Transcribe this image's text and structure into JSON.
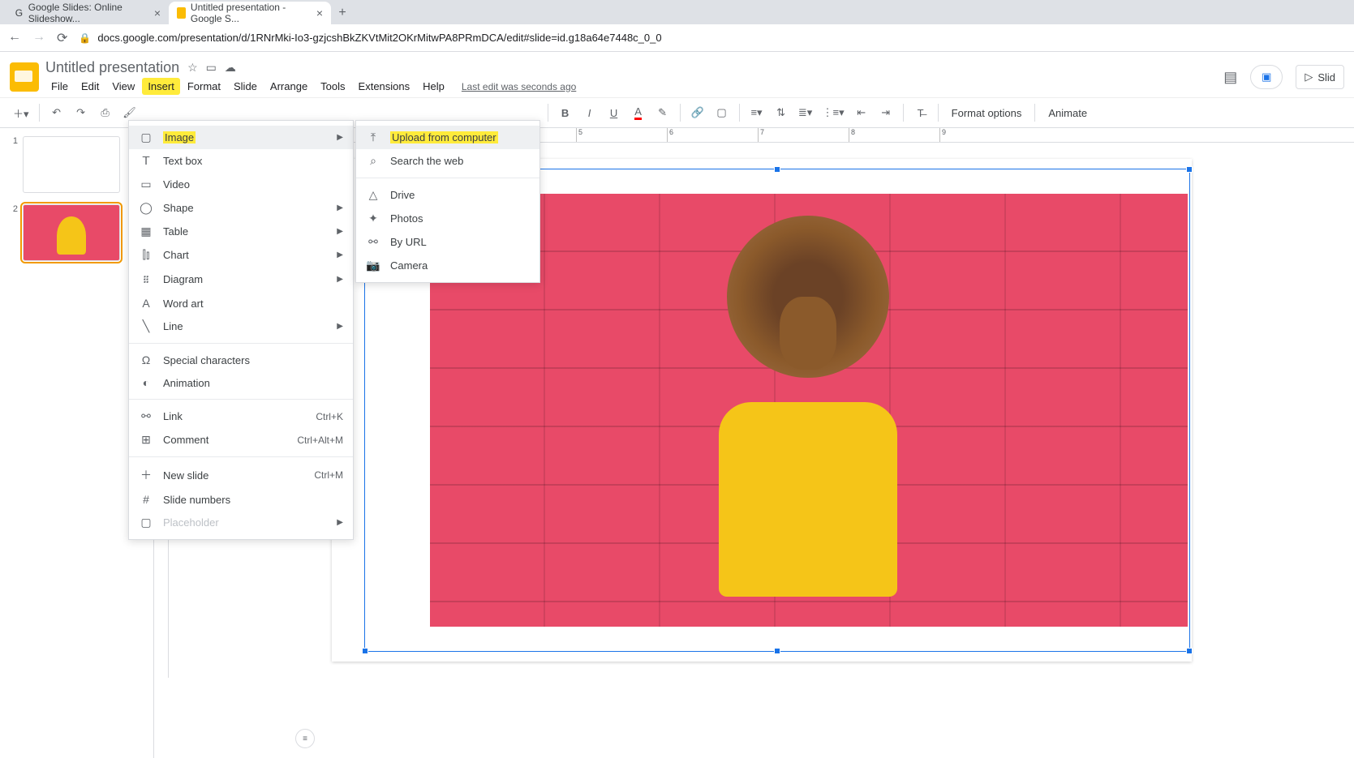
{
  "browser": {
    "tabs": [
      {
        "title": "Google Slides: Online Slideshow...",
        "active": false
      },
      {
        "title": "Untitled presentation - Google S...",
        "active": true
      }
    ],
    "url": "docs.google.com/presentation/d/1RNrMki-Io3-gzjcshBkZKVtMit2OKrMitwPA8PRmDCA/edit#slide=id.g18a64e7448c_0_0"
  },
  "doc": {
    "title": "Untitled presentation",
    "last_edit": "Last edit was seconds ago"
  },
  "menus": {
    "file": "File",
    "edit": "Edit",
    "view": "View",
    "insert": "Insert",
    "format": "Format",
    "slide": "Slide",
    "arrange": "Arrange",
    "tools": "Tools",
    "extensions": "Extensions",
    "help": "Help"
  },
  "toolbar": {
    "bold": "B",
    "italic": "I",
    "underline": "U",
    "textcolor": "A",
    "format_options": "Format options",
    "animate": "Animate"
  },
  "header_right": {
    "slideshow": "Slid"
  },
  "insert_menu": {
    "image": "Image",
    "textbox": "Text box",
    "video": "Video",
    "shape": "Shape",
    "table": "Table",
    "chart": "Chart",
    "diagram": "Diagram",
    "wordart": "Word art",
    "line": "Line",
    "special": "Special characters",
    "animation": "Animation",
    "link": "Link",
    "link_sc": "Ctrl+K",
    "comment": "Comment",
    "comment_sc": "Ctrl+Alt+M",
    "newslide": "New slide",
    "newslide_sc": "Ctrl+M",
    "slidenums": "Slide numbers",
    "placeholder": "Placeholder"
  },
  "image_submenu": {
    "upload": "Upload from computer",
    "search": "Search the web",
    "drive": "Drive",
    "photos": "Photos",
    "byurl": "By URL",
    "camera": "Camera"
  },
  "ruler_ticks": [
    "5",
    "6",
    "7",
    "8",
    "9"
  ],
  "thumbs": {
    "n1": "1",
    "n2": "2"
  }
}
